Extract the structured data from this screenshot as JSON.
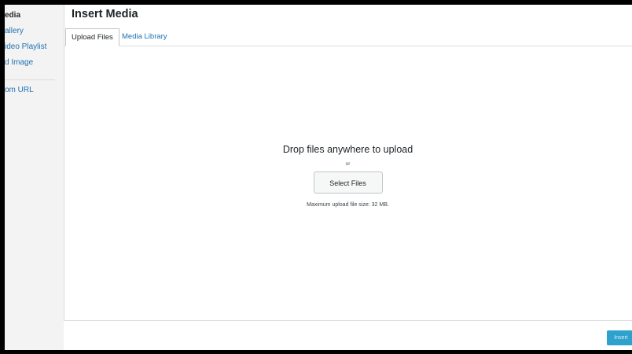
{
  "modal": {
    "title": "Insert Media"
  },
  "sidebar": {
    "items": [
      {
        "label": "edia"
      },
      {
        "label": "allery"
      },
      {
        "label": "ideo Playlist"
      },
      {
        "label": "d Image"
      },
      {
        "label": "om URL"
      }
    ]
  },
  "tabs": [
    {
      "label": "Upload Files",
      "active": true
    },
    {
      "label": "Media Library",
      "active": false
    }
  ],
  "upload": {
    "drop_text": "Drop files anywhere to upload",
    "or_text": "or",
    "select_button": "Select Files",
    "max_size_text": "Maximum upload file size: 32 MB."
  },
  "footer": {
    "insert_button": "Insert"
  },
  "colors": {
    "link": "#2271b1",
    "primary_button": "#2ea2cc",
    "sidebar_bg": "#f3f3f3"
  }
}
